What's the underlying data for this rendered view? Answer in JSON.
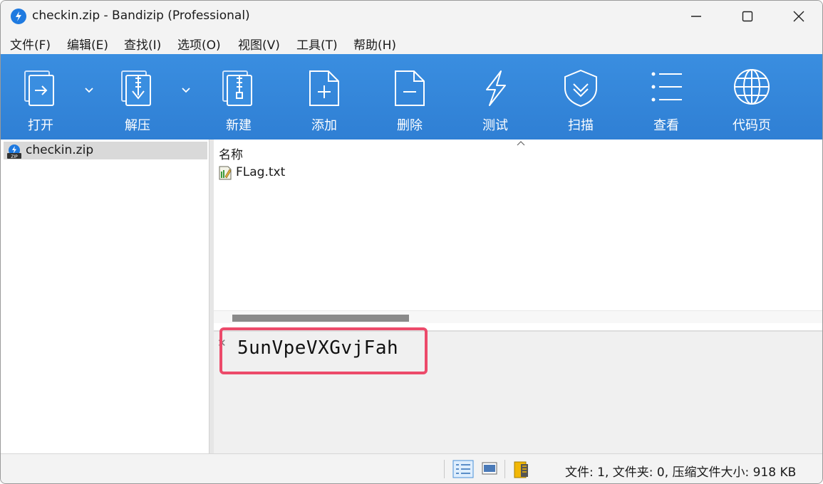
{
  "window": {
    "title": "checkin.zip - Bandizip (Professional)"
  },
  "menu": [
    "文件(F)",
    "编辑(E)",
    "查找(I)",
    "选项(O)",
    "视图(V)",
    "工具(T)",
    "帮助(H)"
  ],
  "toolbar": {
    "open": "打开",
    "extract": "解压",
    "new": "新建",
    "add": "添加",
    "delete": "删除",
    "test": "测试",
    "scan": "扫描",
    "view": "查看",
    "codepage": "代码页"
  },
  "tree": {
    "archive": "checkin.zip"
  },
  "file_list": {
    "column_name": "名称",
    "files": [
      {
        "name": "FLag.txt"
      }
    ]
  },
  "comment": {
    "text": "5unVpeVXGvjFah",
    "highlight_color": "#ec4a6a"
  },
  "status": {
    "summary": "文件: 1, 文件夹: 0, 压缩文件大小: 918 KB"
  },
  "colors": {
    "toolbar": "#2f7fd4",
    "accent": "#1f7ae0"
  }
}
